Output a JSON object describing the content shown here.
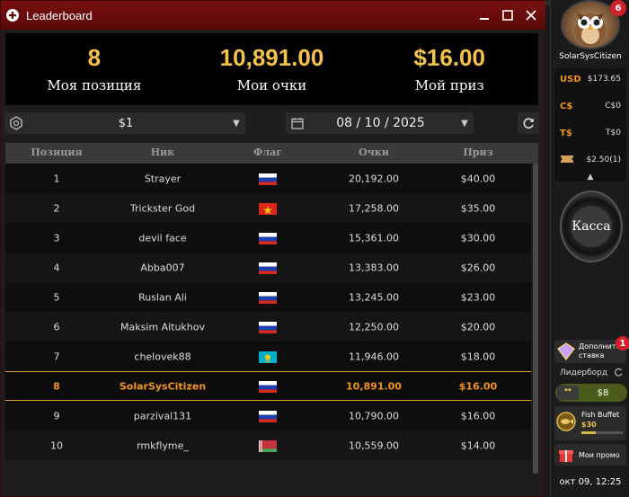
{
  "window": {
    "title": "Leaderboard"
  },
  "summary": [
    {
      "value": "8",
      "label": "Моя позиция"
    },
    {
      "value": "10,891.00",
      "label": "Мои очки"
    },
    {
      "value": "$16.00",
      "label": "Мой приз"
    }
  ],
  "filters": {
    "stake": "$1",
    "date": "08 / 10 / 2025"
  },
  "table": {
    "headers": [
      "Позиция",
      "Ник",
      "Флаг",
      "Очки",
      "Приз"
    ],
    "rows": [
      {
        "pos": "1",
        "nick": "Strayer",
        "flag": "ru",
        "points": "20,192.00",
        "prize": "$40.00"
      },
      {
        "pos": "2",
        "nick": "Trickster God",
        "flag": "vn",
        "points": "17,258.00",
        "prize": "$35.00"
      },
      {
        "pos": "3",
        "nick": "devil face",
        "flag": "ru",
        "points": "15,361.00",
        "prize": "$30.00"
      },
      {
        "pos": "4",
        "nick": "Abba007",
        "flag": "ru",
        "points": "13,383.00",
        "prize": "$26.00"
      },
      {
        "pos": "5",
        "nick": "Ruslan Ali",
        "flag": "ru",
        "points": "13,245.00",
        "prize": "$23.00"
      },
      {
        "pos": "6",
        "nick": "Maksim Altukhov",
        "flag": "ru",
        "points": "12,250.00",
        "prize": "$20.00"
      },
      {
        "pos": "7",
        "nick": "chelovek88",
        "flag": "kz",
        "points": "11,946.00",
        "prize": "$18.00"
      },
      {
        "pos": "8",
        "nick": "SolarSysCitizen",
        "flag": "ru",
        "points": "10,891.00",
        "prize": "$16.00",
        "me": true
      },
      {
        "pos": "9",
        "nick": "parzival131",
        "flag": "ru",
        "points": "10,790.00",
        "prize": "$16.00"
      },
      {
        "pos": "10",
        "nick": "rmkflyme_",
        "flag": "by",
        "points": "10,559.00",
        "prize": "$14.00"
      }
    ]
  },
  "sidebar": {
    "notifications": "6",
    "username": "SolarSysCitizen",
    "balances": [
      {
        "currency": "USD",
        "amount": "$173.65"
      },
      {
        "currency": "C$",
        "amount": "C$0"
      },
      {
        "currency": "T$",
        "amount": "T$0"
      },
      {
        "currency": "",
        "amount": "$2.50(1)"
      }
    ],
    "cashier": "Касса",
    "extra_bet": {
      "label": "Дополнительная ставка",
      "badge": "1"
    },
    "leaderboard": {
      "label": "Лидерборд",
      "value": "$8"
    },
    "fish_buffet": {
      "label": "Fish Buffet",
      "value": "$30",
      "progress": 0.35
    },
    "my_promo": "Мои промо",
    "clock": "окт 09, 12:25"
  },
  "colors": {
    "accent": "#f5c24b",
    "highlight": "#f29419",
    "title_bar": "#6b0c0c"
  }
}
